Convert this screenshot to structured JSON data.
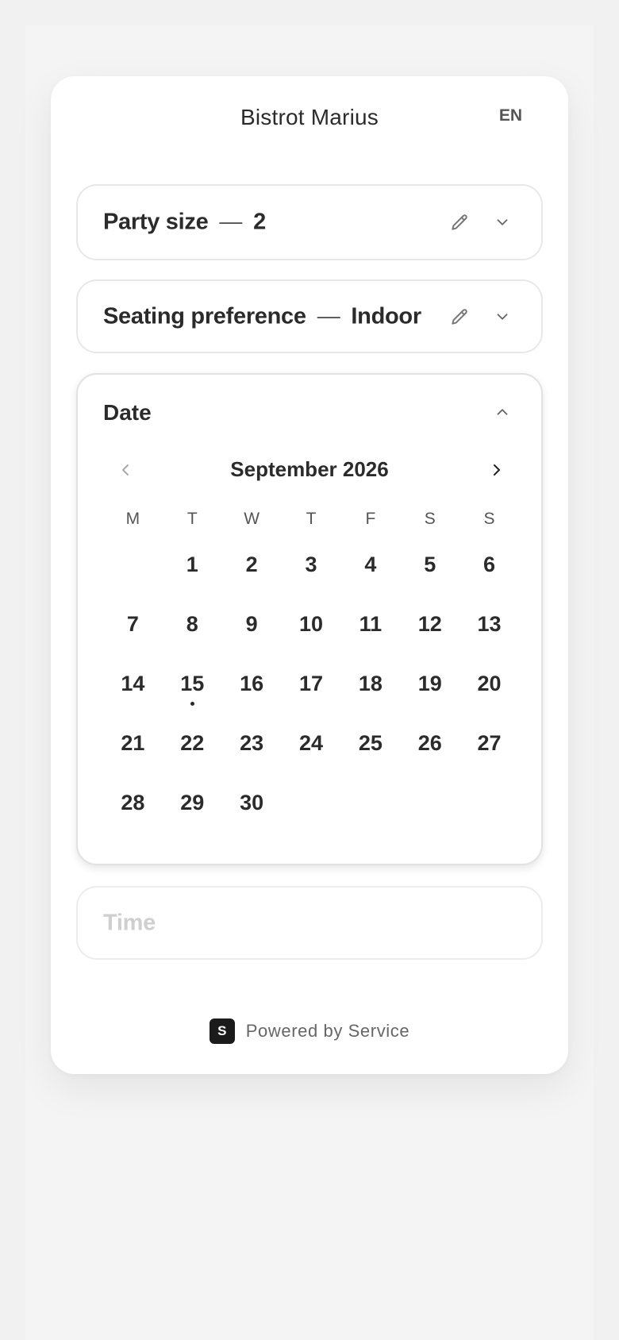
{
  "header": {
    "title": "Bistrot Marius",
    "language": "EN"
  },
  "party": {
    "label": "Party size",
    "value": "2"
  },
  "seating": {
    "label": "Seating preference",
    "value": "Indoor"
  },
  "date": {
    "label": "Date",
    "month": "September 2026",
    "weekdays": [
      "M",
      "T",
      "W",
      "T",
      "F",
      "S",
      "S"
    ],
    "weeks": [
      [
        "",
        "1",
        "2",
        "3",
        "4",
        "5",
        "6"
      ],
      [
        "7",
        "8",
        "9",
        "10",
        "11",
        "12",
        "13"
      ],
      [
        "14",
        "15",
        "16",
        "17",
        "18",
        "19",
        "20"
      ],
      [
        "21",
        "22",
        "23",
        "24",
        "25",
        "26",
        "27"
      ],
      [
        "28",
        "29",
        "30",
        "",
        "",
        "",
        ""
      ]
    ],
    "today": "15"
  },
  "time": {
    "label": "Time"
  },
  "footer": {
    "badge": "S",
    "text": "Powered by Service"
  },
  "icons": {
    "edit": "pencil-icon",
    "expand": "chevron-down-icon",
    "collapse": "chevron-up-icon",
    "prev": "chevron-left-icon",
    "next": "chevron-right-icon"
  },
  "colors": {
    "text": "#2b2b2b",
    "muted": "#555555",
    "border": "#e8e8e8",
    "badge": "#1b1b1b",
    "placeholder": "#cfcfcf"
  }
}
